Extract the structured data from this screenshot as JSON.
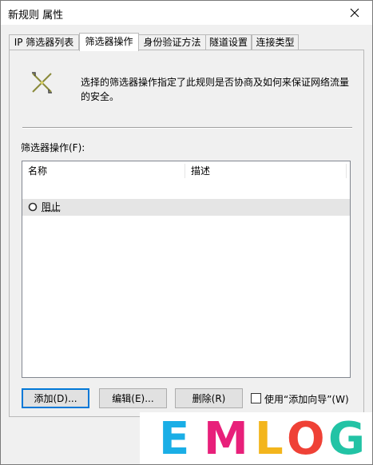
{
  "window": {
    "title": "新规则 属性"
  },
  "tabs": [
    {
      "label": "IP 筛选器列表"
    },
    {
      "label": "筛选器操作"
    },
    {
      "label": "身份验证方法"
    },
    {
      "label": "隧道设置"
    },
    {
      "label": "连接类型"
    }
  ],
  "panel": {
    "description": "选择的筛选器操作指定了此规则是否协商及如何来保证网络流量的安全。",
    "list_label": "筛选器操作(F):",
    "columns": [
      {
        "label": "名称"
      },
      {
        "label": "描述"
      }
    ],
    "rows": [
      {
        "name": "阻止",
        "description": "",
        "selected": true
      }
    ]
  },
  "buttons": {
    "add": "添加(D)...",
    "edit": "编辑(E)...",
    "remove": "删除(R)",
    "use_wizard": "使用“添加向导”(W)",
    "use_wizard_checked": false
  },
  "watermark": {
    "letters": [
      "E",
      "M",
      "L",
      "O",
      "G"
    ],
    "colors": [
      "#1aaee6",
      "#e8207a",
      "#f3b51c",
      "#ef4136",
      "#22c3a5"
    ]
  },
  "colors": {
    "accent": "#0078d7",
    "selected_row": "#e5e5e5"
  },
  "icons": {
    "close": "close-icon",
    "rule": "filter-action-icon",
    "row": "radio-circle-icon"
  }
}
